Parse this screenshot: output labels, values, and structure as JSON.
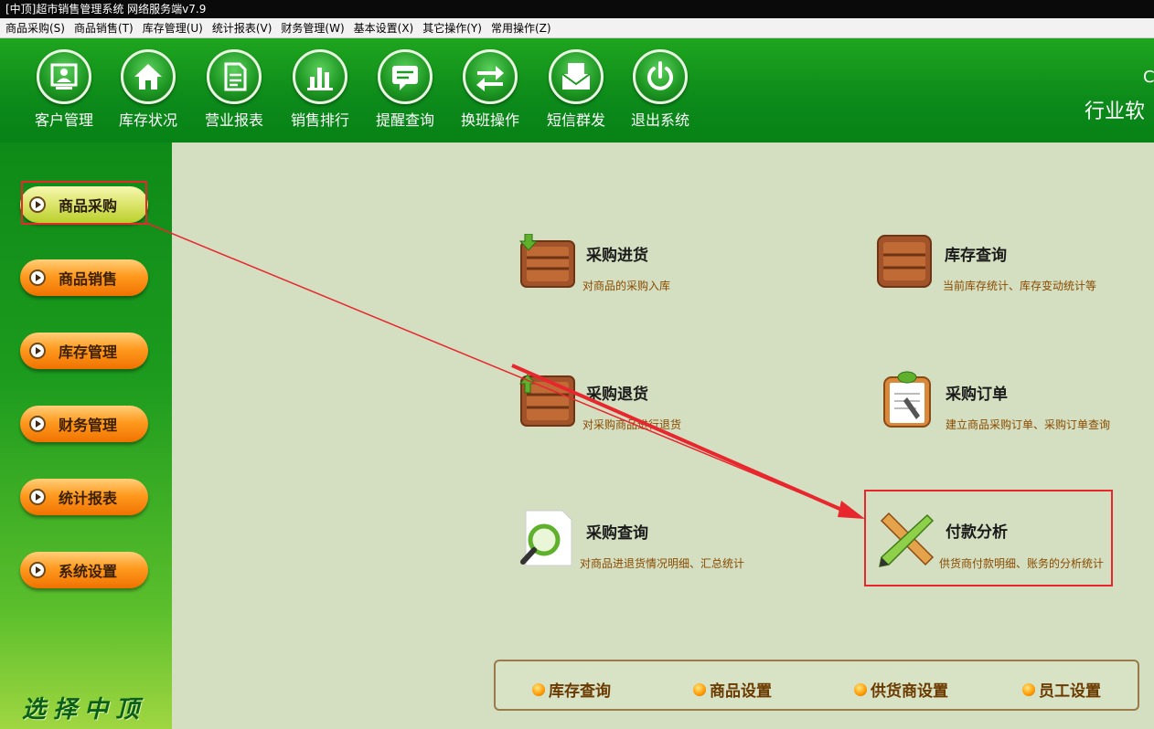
{
  "window": {
    "title": "[中顶]超市销售管理系统 网络服务端v7.9"
  },
  "menu": [
    "商品采购(S)",
    "商品销售(T)",
    "库存管理(U)",
    "统计报表(V)",
    "财务管理(W)",
    "基本设置(X)",
    "其它操作(Y)",
    "常用操作(Z)"
  ],
  "toolbar": {
    "buttons": [
      {
        "label": "客户管理",
        "icon": "customer-icon"
      },
      {
        "label": "库存状况",
        "icon": "home-icon"
      },
      {
        "label": "营业报表",
        "icon": "report-icon"
      },
      {
        "label": "销售排行",
        "icon": "bar-chart-icon"
      },
      {
        "label": "提醒查询",
        "icon": "message-icon"
      },
      {
        "label": "换班操作",
        "icon": "swap-icon"
      },
      {
        "label": "短信群发",
        "icon": "envelope-icon"
      },
      {
        "label": "退出系统",
        "icon": "power-icon"
      }
    ],
    "brand_top": "C",
    "brand": "行业软"
  },
  "sidebar": {
    "items": [
      {
        "label": "商品采购",
        "active": true
      },
      {
        "label": "商品销售",
        "active": false
      },
      {
        "label": "库存管理",
        "active": false
      },
      {
        "label": "财务管理",
        "active": false
      },
      {
        "label": "统计报表",
        "active": false
      },
      {
        "label": "系统设置",
        "active": false
      }
    ],
    "slogan": "选择中顶"
  },
  "main": {
    "items": [
      {
        "title": "采购进货",
        "desc": "对商品的采购入库",
        "icon": "crate-in-icon"
      },
      {
        "title": "库存查询",
        "desc": "当前库存统计、库存变动统计等",
        "icon": "crate-icon"
      },
      {
        "title": "采购退货",
        "desc": "对采购商品进行退货",
        "icon": "crate-return-icon"
      },
      {
        "title": "采购订单",
        "desc": "建立商品采购订单、采购订单查询",
        "icon": "clipboard-icon"
      },
      {
        "title": "采购查询",
        "desc": "对商品进退货情况明细、汇总统计",
        "icon": "magnifier-icon"
      },
      {
        "title": "付款分析",
        "desc": "供货商付款明细、账务的分析统计",
        "icon": "pencil-ruler-icon"
      }
    ]
  },
  "bottom": {
    "items": [
      "库存查询",
      "商品设置",
      "供货商设置",
      "员工设置"
    ]
  },
  "colors": {
    "toolbar_green": "#0c8a1a",
    "highlight_red": "#e8262e",
    "orange_button": "#ff9a1f",
    "main_bg": "#d3dfc0"
  }
}
